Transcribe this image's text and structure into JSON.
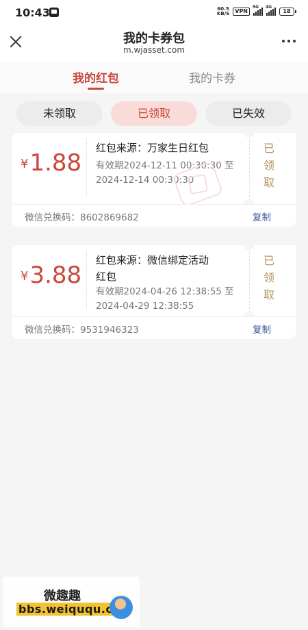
{
  "status_bar": {
    "time": "10:43",
    "net_speed_value": "60.5",
    "net_speed_unit": "KB/S",
    "vpn": "VPN",
    "sig1": "5G",
    "sig2": "4G",
    "battery": "18"
  },
  "header": {
    "title": "我的卡券包",
    "subtitle": "m.wjasset.com"
  },
  "tabs": [
    {
      "label": "我的红包",
      "active": true
    },
    {
      "label": "我的卡券",
      "active": false
    }
  ],
  "filters": [
    {
      "label": "未领取",
      "active": false
    },
    {
      "label": "已领取",
      "active": true
    },
    {
      "label": "已失效",
      "active": false
    }
  ],
  "cards": [
    {
      "currency": "¥",
      "amount": "1.88",
      "source_line1": "红包来源：万家生日红包",
      "source_line2": "",
      "validity_line1": "有效期2024-12-11 00:30:30 至",
      "validity_line2": "2024-12-14 00:30:30",
      "status": [
        "已",
        "领",
        "取"
      ],
      "code": "微信兑换码：8602869682",
      "copy_label": "复制"
    },
    {
      "currency": "¥",
      "amount": "3.88",
      "source_line1": "红包来源：微信绑定活动",
      "source_line2": "红包",
      "validity_line1": "有效期2024-04-26 12:38:55 至",
      "validity_line2": "2024-04-29 12:38:55",
      "status": [
        "已",
        "领",
        "取"
      ],
      "code": "微信兑换码：9531946323",
      "copy_label": "复制"
    }
  ],
  "forum_watermark": {
    "title": "微趣趣",
    "url": "bbs.weiququ.cn"
  },
  "colors": {
    "accent": "#c9473d",
    "claimed_text": "#b6935b",
    "link": "#3b5998"
  }
}
